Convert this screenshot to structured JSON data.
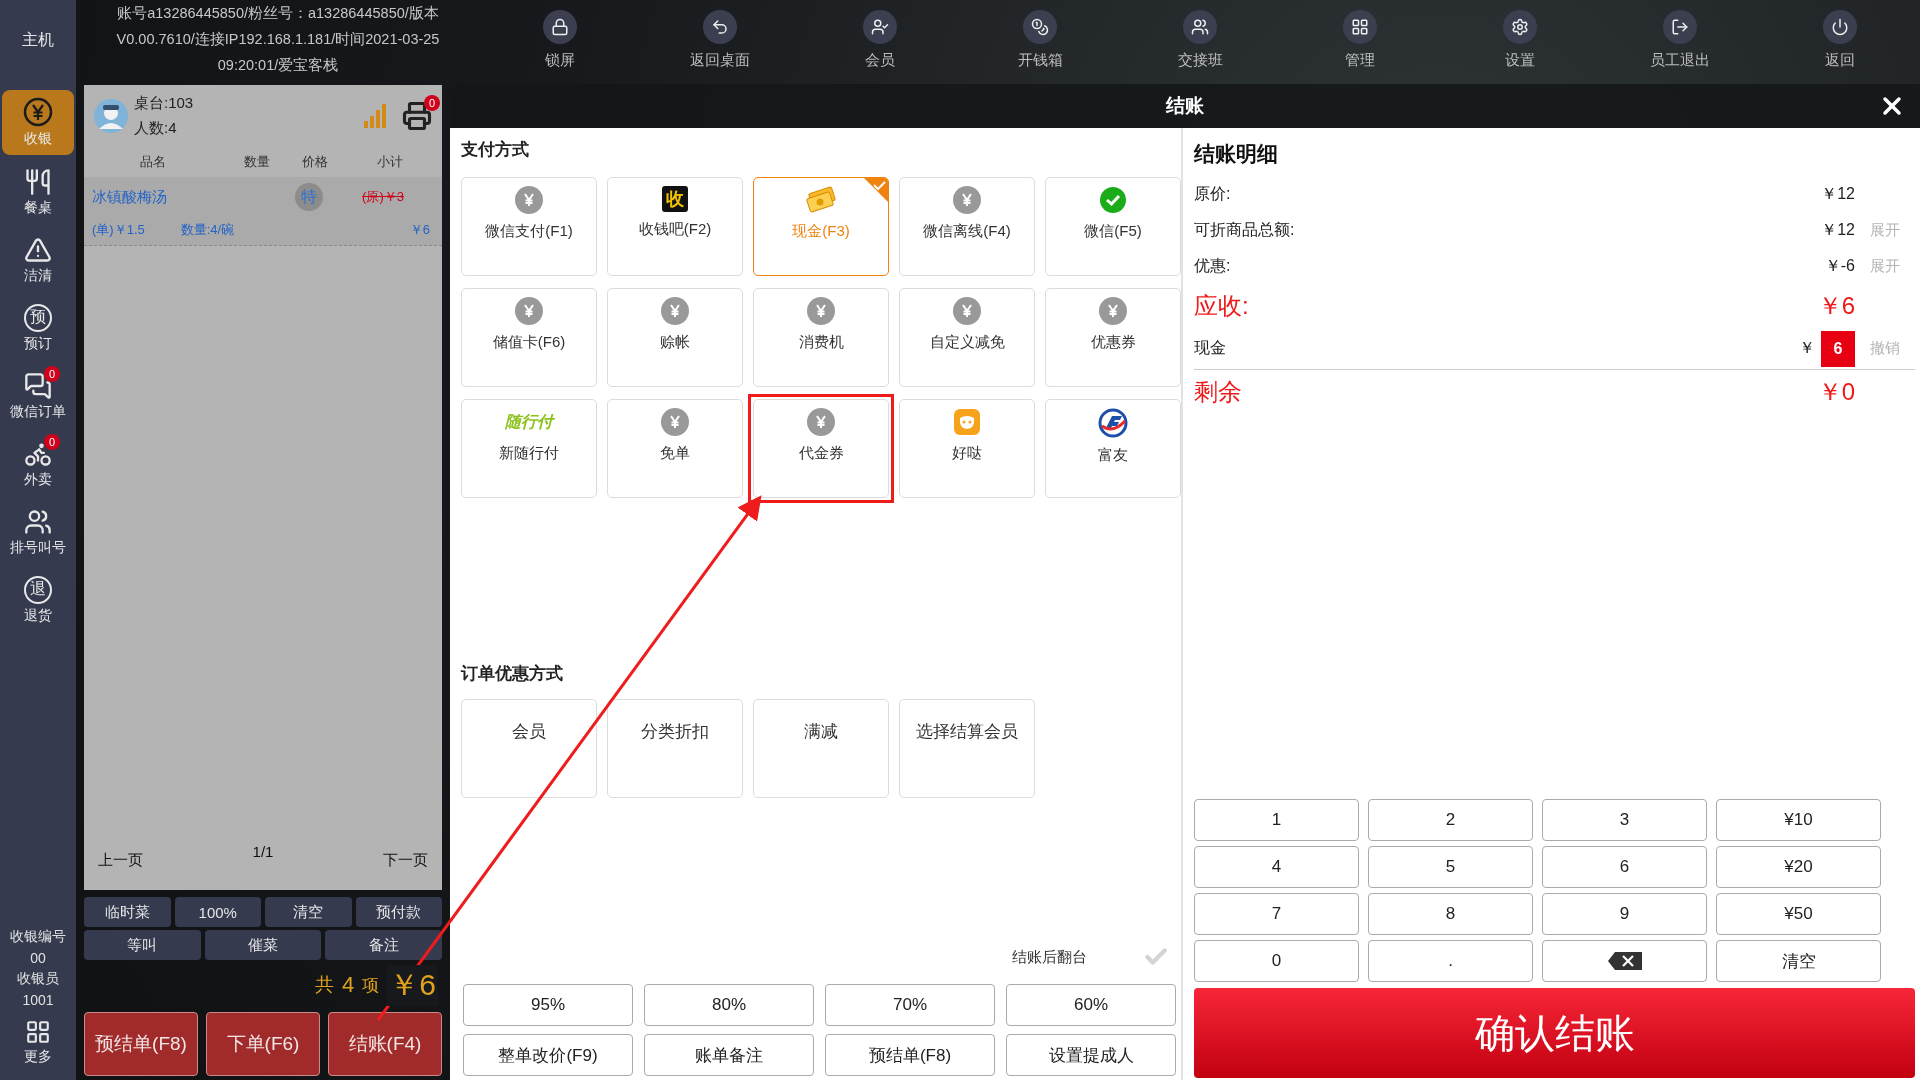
{
  "sidebar": {
    "title": "主机",
    "items": [
      {
        "label": "收银",
        "kind": "yen",
        "selected": true
      },
      {
        "label": "餐桌",
        "kind": "utensils",
        "selected": false
      },
      {
        "label": "洁清",
        "kind": "alert",
        "selected": false
      },
      {
        "label": "预订",
        "kind": "glyph",
        "glyph": "预",
        "selected": false
      },
      {
        "label": "微信订单",
        "kind": "chat",
        "badge": "0",
        "selected": false
      },
      {
        "label": "外卖",
        "kind": "takeout",
        "badge": "0",
        "selected": false
      },
      {
        "label": "排号叫号",
        "kind": "people",
        "selected": false
      },
      {
        "label": "退货",
        "kind": "glyph",
        "glyph": "退",
        "selected": false
      }
    ],
    "footer": [
      "收银编号",
      "00",
      "收银员",
      "1001"
    ],
    "more": "更多"
  },
  "info_lines": [
    "账号a13286445850/粉丝号：a13286445850/版本",
    "V0.00.7610/连接IP192.168.1.181/时间2021-03-25",
    "09:20:01/爱宝客栈"
  ],
  "toolbar": [
    {
      "label": "锁屏",
      "kind": "lock"
    },
    {
      "label": "返回桌面",
      "kind": "undo"
    },
    {
      "label": "会员",
      "kind": "member"
    },
    {
      "label": "开钱箱",
      "kind": "coins"
    },
    {
      "label": "交接班",
      "kind": "users"
    },
    {
      "label": "管理",
      "kind": "grid"
    },
    {
      "label": "设置",
      "kind": "settings"
    },
    {
      "label": "员工退出",
      "kind": "logout"
    },
    {
      "label": "返回",
      "kind": "power"
    }
  ],
  "order": {
    "table": "桌台:103",
    "guests": "人数:4",
    "printer_badge": "0",
    "columns": [
      "品名",
      "数量",
      "价格",
      "小计"
    ],
    "items": [
      {
        "name": "冰镇酸梅汤",
        "tag": "特",
        "original": "(原)￥3",
        "unit": "(单)￥1.5",
        "qty": "数量:4/碗",
        "subtotal": "￥6"
      }
    ],
    "pager": {
      "prev": "上一页",
      "page": "1/1",
      "next": "下一页"
    },
    "actions": [
      "临时菜",
      "100%",
      "清空",
      "预付款"
    ],
    "actions2": [
      "等叫",
      "催菜",
      "备注"
    ],
    "total": {
      "prefix": "共",
      "count": "4",
      "unit": "项",
      "amount": "￥6"
    },
    "buttons": [
      "预结单(F8)",
      "下单(F6)",
      "结账(F4)"
    ]
  },
  "checkout": {
    "title": "结账",
    "payment": {
      "title": "支付方式",
      "methods": [
        {
          "label": "微信支付(F1)",
          "kind": "yen",
          "selected": false,
          "highlighted": false
        },
        {
          "label": "收钱吧(F2)",
          "kind": "shou",
          "icon_text": "收",
          "selected": false,
          "highlighted": false
        },
        {
          "label": "现金(F3)",
          "kind": "cash",
          "selected": true,
          "highlighted": false
        },
        {
          "label": "微信离线(F4)",
          "kind": "yen",
          "selected": false,
          "highlighted": false
        },
        {
          "label": "微信(F5)",
          "kind": "wechat",
          "selected": false,
          "highlighted": false
        },
        {
          "label": "储值卡(F6)",
          "kind": "yen",
          "selected": false,
          "highlighted": false
        },
        {
          "label": "赊帐",
          "kind": "yen",
          "selected": false,
          "highlighted": false
        },
        {
          "label": "消费机",
          "kind": "yen",
          "selected": false,
          "highlighted": false
        },
        {
          "label": "自定义减免",
          "kind": "yen",
          "selected": false,
          "highlighted": false
        },
        {
          "label": "优惠券",
          "kind": "yen",
          "selected": false,
          "highlighted": false
        },
        {
          "label": "新随行付",
          "kind": "suixing",
          "icon_text": "随行付",
          "selected": false,
          "highlighted": false
        },
        {
          "label": "免单",
          "kind": "yen",
          "selected": false,
          "highlighted": false
        },
        {
          "label": "代金券",
          "kind": "yen",
          "selected": false,
          "highlighted": true
        },
        {
          "label": "好哒",
          "kind": "haoda",
          "selected": false,
          "highlighted": false
        },
        {
          "label": "富友",
          "kind": "fuyou",
          "selected": false,
          "highlighted": false
        }
      ]
    },
    "discounts": {
      "title": "订单优惠方式",
      "items": [
        "会员",
        "分类折扣",
        "满减",
        "选择结算会员"
      ]
    },
    "flip": {
      "label": "结账后翻台",
      "checked": false
    },
    "quick": [
      "95%",
      "80%",
      "70%",
      "60%"
    ],
    "actions": [
      "整单改价(F9)",
      "账单备注",
      "预结单(F8)",
      "设置提成人"
    ],
    "detail": {
      "title": "结账明细",
      "rows": [
        {
          "kind": "plain",
          "label": "原价:",
          "value": "￥12"
        },
        {
          "kind": "plain",
          "label": "可折商品总额:",
          "value": "￥12",
          "action": "展开"
        },
        {
          "kind": "plain",
          "label": "优惠:",
          "value": "￥-6",
          "action": "展开"
        },
        {
          "kind": "due",
          "label": "应收:",
          "value": "￥6"
        },
        {
          "kind": "input",
          "label": "现金",
          "currency": "￥",
          "value": "6",
          "action": "撤销"
        },
        {
          "kind": "due",
          "label": "剩余",
          "value": "￥0"
        }
      ]
    },
    "keypad": [
      {
        "kind": "key",
        "label": "1"
      },
      {
        "kind": "key",
        "label": "2"
      },
      {
        "kind": "key",
        "label": "3"
      },
      {
        "kind": "key",
        "label": "¥10"
      },
      {
        "kind": "key",
        "label": "4"
      },
      {
        "kind": "key",
        "label": "5"
      },
      {
        "kind": "key",
        "label": "6"
      },
      {
        "kind": "key",
        "label": "¥20"
      },
      {
        "kind": "key",
        "label": "7"
      },
      {
        "kind": "key",
        "label": "8"
      },
      {
        "kind": "key",
        "label": "9"
      },
      {
        "kind": "key",
        "label": "¥50"
      },
      {
        "kind": "key",
        "label": "0"
      },
      {
        "kind": "key",
        "label": "."
      },
      {
        "kind": "backspace"
      },
      {
        "kind": "key",
        "label": "清空"
      }
    ],
    "confirm": "确认结账"
  },
  "annotation_arrow": true
}
